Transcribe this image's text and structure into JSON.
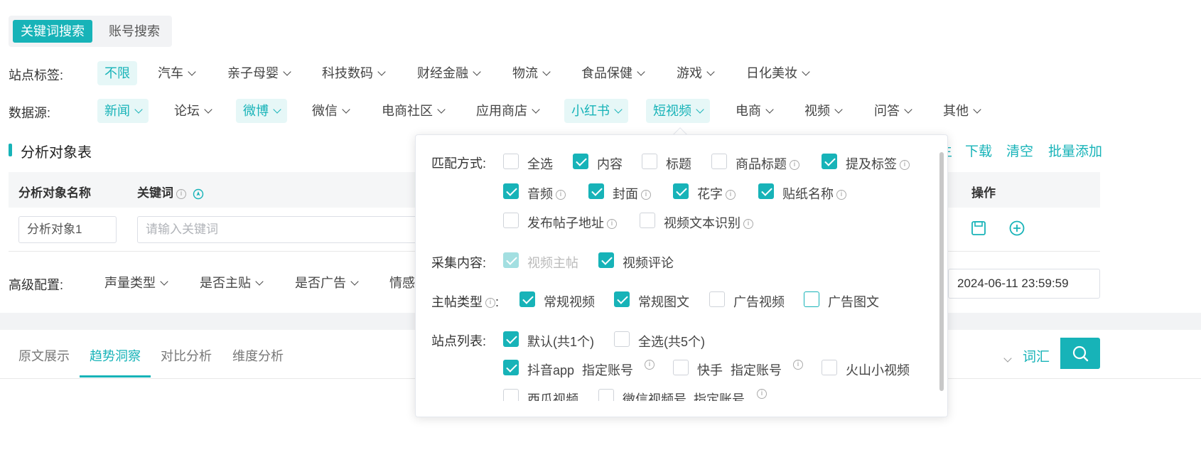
{
  "search_modes": [
    "关键词搜索",
    "账号搜索"
  ],
  "site_tags": {
    "label": "站点标签:",
    "items": [
      {
        "text": "不限",
        "selected": true,
        "chevron": false
      },
      {
        "text": "汽车",
        "selected": false,
        "chevron": true
      },
      {
        "text": "亲子母婴",
        "selected": false,
        "chevron": true
      },
      {
        "text": "科技数码",
        "selected": false,
        "chevron": true
      },
      {
        "text": "财经金融",
        "selected": false,
        "chevron": true
      },
      {
        "text": "物流",
        "selected": false,
        "chevron": true
      },
      {
        "text": "食品保健",
        "selected": false,
        "chevron": true
      },
      {
        "text": "游戏",
        "selected": false,
        "chevron": true
      },
      {
        "text": "日化美妆",
        "selected": false,
        "chevron": true
      }
    ]
  },
  "data_sources": {
    "label": "数据源:",
    "items": [
      {
        "text": "新闻",
        "selected": true
      },
      {
        "text": "论坛",
        "selected": false
      },
      {
        "text": "微博",
        "selected": true
      },
      {
        "text": "微信",
        "selected": false
      },
      {
        "text": "电商社区",
        "selected": false
      },
      {
        "text": "应用商店",
        "selected": false
      },
      {
        "text": "小红书",
        "selected": true
      },
      {
        "text": "短视频",
        "selected": true
      },
      {
        "text": "电商",
        "selected": false
      },
      {
        "text": "视频",
        "selected": false
      },
      {
        "text": "问答",
        "selected": false
      },
      {
        "text": "其他",
        "selected": false
      }
    ]
  },
  "analysis": {
    "title": "分析对象表",
    "links": [
      "下载",
      "清空",
      "批量添加"
    ],
    "link_partial": "主",
    "columns": {
      "name": "分析对象名称",
      "keyword": "关键词",
      "action": "操作"
    },
    "row": {
      "name_value": "分析对象1",
      "keyword_placeholder": "请输入关键词"
    }
  },
  "advanced": {
    "label": "高级配置:",
    "items": [
      "声量类型",
      "是否主贴",
      "是否广告"
    ],
    "partial_item": "情感",
    "date_value": "2024-06-11 23:59:59"
  },
  "bottom_tabs": [
    "原文展示",
    "趋势洞察",
    "对比分析",
    "维度分析"
  ],
  "active_bottom_tab": 1,
  "vocab_link": "词汇",
  "panel": {
    "match_label": "匹配方式:",
    "match_options": [
      {
        "text": "全选",
        "checked": false
      },
      {
        "text": "内容",
        "checked": true
      },
      {
        "text": "标题",
        "checked": false
      },
      {
        "text": "商品标题",
        "checked": false
      },
      {
        "text": "提及标签",
        "checked": true
      },
      {
        "text": "音频",
        "checked": true
      },
      {
        "text": "封面",
        "checked": true
      },
      {
        "text": "花字",
        "checked": true
      },
      {
        "text": "贴纸名称",
        "checked": true
      },
      {
        "text": "发布帖子地址",
        "checked": false
      },
      {
        "text": "视频文本识别",
        "checked": false
      }
    ],
    "collect_label": "采集内容:",
    "collect_options": [
      {
        "text": "视频主帖",
        "checked": true,
        "disabled": true
      },
      {
        "text": "视频评论",
        "checked": true,
        "disabled": false
      }
    ],
    "post_type_label": "主帖类型",
    "post_type_options": [
      {
        "text": "常规视频",
        "checked": true
      },
      {
        "text": "常规图文",
        "checked": true
      },
      {
        "text": "广告视频",
        "checked": false
      },
      {
        "text": "广告图文",
        "checked": false
      }
    ],
    "site_list_label": "站点列表:",
    "site_options": [
      {
        "text": "默认(共1个)",
        "checked": true
      },
      {
        "text": "全选(共5个)",
        "checked": false
      },
      {
        "text": "抖音app",
        "checked": true,
        "link": "指定账号"
      },
      {
        "text": "快手",
        "checked": false,
        "link": "指定账号"
      },
      {
        "text": "火山小视频",
        "checked": false
      },
      {
        "text": "西瓜视频",
        "checked": false
      },
      {
        "text": "微信视频号",
        "checked": false,
        "link": "指定账号"
      }
    ]
  },
  "colors": {
    "accent": "#17b3b8",
    "accent_light": "#e6f7f7"
  }
}
